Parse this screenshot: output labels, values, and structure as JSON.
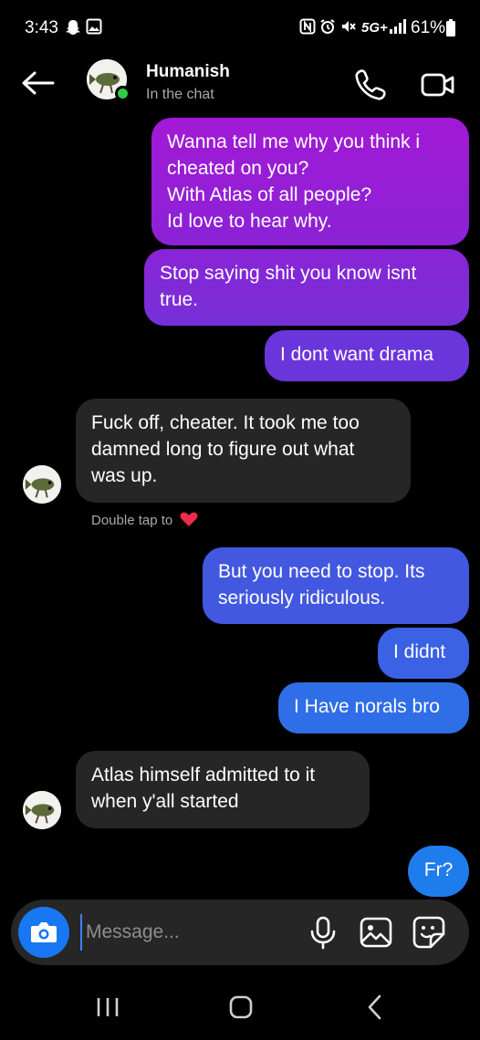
{
  "status_bar": {
    "time": "3:43",
    "battery": "61%",
    "network": "5G+"
  },
  "header": {
    "name": "Humanish",
    "status": "In the chat"
  },
  "messages": [
    {
      "direction": "out",
      "text": "Wanna tell me why you think i\ncheated on you?\nWith Atlas of all people?\nId love to hear why.",
      "color": "#9b17d4"
    },
    {
      "direction": "out",
      "text": "Stop saying shit you know isnt\ntrue.",
      "color": "#8326d6"
    },
    {
      "direction": "out",
      "text": "I dont want drama",
      "color": "#6a35dc"
    },
    {
      "direction": "in",
      "text": "Fuck off, cheater. It took me too\ndamned long to figure out what\nwas up."
    },
    {
      "direction": "out",
      "text": "But you need to stop. Its\nseriously ridiculous.",
      "color": "#3f5fe0"
    },
    {
      "direction": "out",
      "text": "I didnt",
      "color": "#3a63e3"
    },
    {
      "direction": "out",
      "text": "I Have norals bro",
      "color": "#2f6fe6"
    },
    {
      "direction": "in",
      "text": "Atlas himself admitted to it\nwhen y'all started"
    },
    {
      "direction": "out",
      "text": "Fr?",
      "color": "#1f7cec"
    }
  ],
  "double_tap_hint": "Double tap to",
  "composer": {
    "placeholder": "Message..."
  },
  "icons": {
    "back": "arrow-left-icon",
    "call": "phone-icon",
    "video": "video-camera-icon",
    "camera": "camera-icon",
    "mic": "microphone-icon",
    "gallery": "image-icon",
    "sticker": "sticker-icon",
    "heart": "heart-icon"
  },
  "colors": {
    "background": "#000000",
    "incoming_bubble": "#262626",
    "accent_blue": "#1877f2",
    "online": "#2ecc49"
  }
}
